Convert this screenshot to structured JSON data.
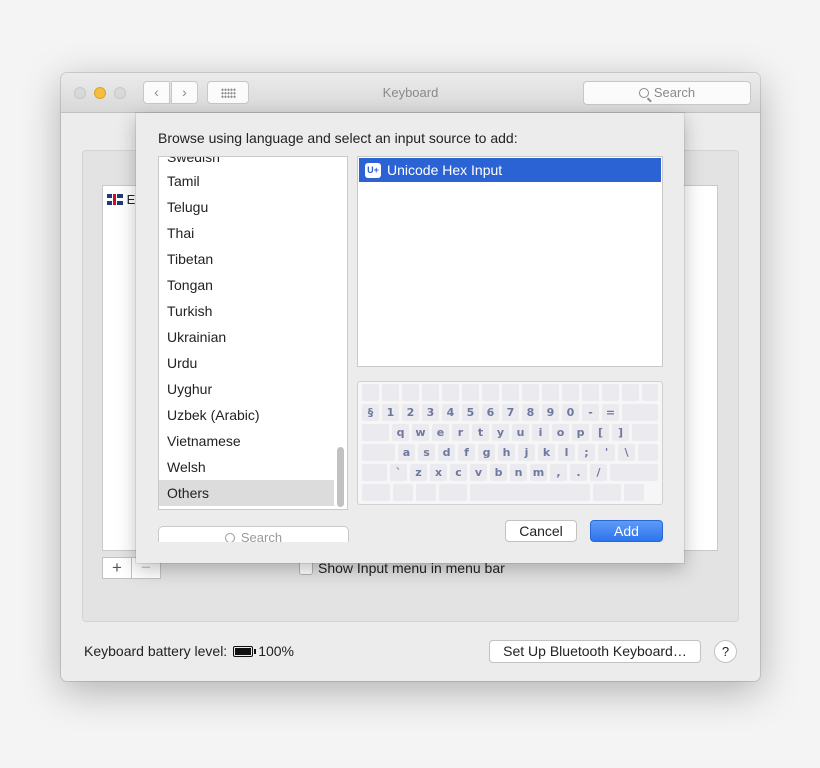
{
  "window": {
    "title": "Keyboard",
    "search_placeholder": "Search",
    "back_glyph": "‹",
    "forward_glyph": "›"
  },
  "background_panel": {
    "source_list_partial": "E",
    "plus_label": "+",
    "minus_label": "−",
    "show_input_menu_label": "Show Input menu in menu bar",
    "show_input_menu_checked": false
  },
  "footer": {
    "battery_label": "Keyboard battery level:",
    "battery_value": "100%",
    "bluetooth_button": "Set Up Bluetooth Keyboard…",
    "help_button": "?"
  },
  "sheet": {
    "prompt": "Browse using language and select an input source to add:",
    "languages_partial_top": "Swedish",
    "languages": [
      "Tamil",
      "Telugu",
      "Thai",
      "Tibetan",
      "Tongan",
      "Turkish",
      "Ukrainian",
      "Urdu",
      "Uyghur",
      "Uzbek (Arabic)",
      "Vietnamese",
      "Welsh",
      "Others"
    ],
    "selected_language": "Others",
    "search_placeholder": "Search",
    "input_sources": [
      {
        "icon_text": "U+",
        "label": "Unicode Hex Input",
        "selected": true
      }
    ],
    "keyboard_rows": [
      [
        "§",
        "1",
        "2",
        "3",
        "4",
        "5",
        "6",
        "7",
        "8",
        "9",
        "0",
        "-",
        "="
      ],
      [
        "q",
        "w",
        "e",
        "r",
        "t",
        "y",
        "u",
        "i",
        "o",
        "p",
        "[",
        "]"
      ],
      [
        "a",
        "s",
        "d",
        "f",
        "g",
        "h",
        "j",
        "k",
        "l",
        ";",
        "'",
        "\\"
      ],
      [
        "`",
        "z",
        "x",
        "c",
        "v",
        "b",
        "n",
        "m",
        ",",
        ".",
        "/"
      ]
    ],
    "cancel_button": "Cancel",
    "add_button": "Add"
  },
  "colors": {
    "selection_blue": "#2b63d4",
    "add_button_blue": "#2d74ee",
    "key_text": "#6f78a0",
    "minimize_yellow": "#f5be3f"
  }
}
